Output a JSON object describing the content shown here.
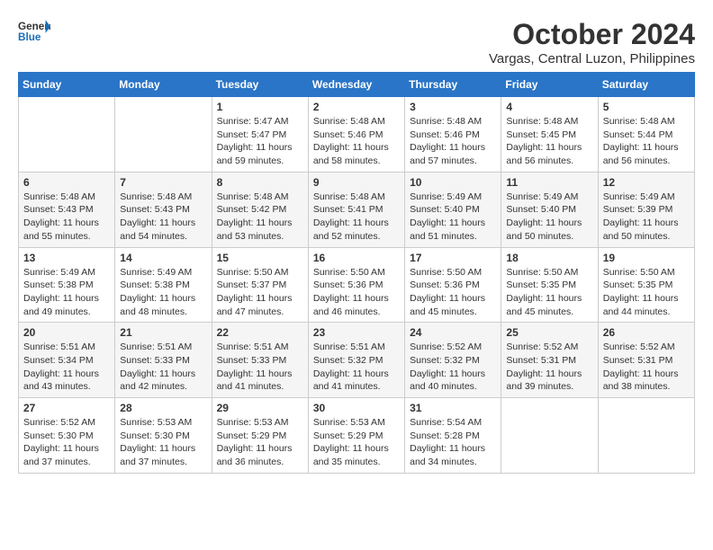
{
  "header": {
    "logo_line1": "General",
    "logo_line2": "Blue",
    "month_title": "October 2024",
    "location": "Vargas, Central Luzon, Philippines"
  },
  "weekdays": [
    "Sunday",
    "Monday",
    "Tuesday",
    "Wednesday",
    "Thursday",
    "Friday",
    "Saturday"
  ],
  "weeks": [
    [
      {
        "day": "",
        "info": ""
      },
      {
        "day": "",
        "info": ""
      },
      {
        "day": "1",
        "info": "Sunrise: 5:47 AM\nSunset: 5:47 PM\nDaylight: 11 hours and 59 minutes."
      },
      {
        "day": "2",
        "info": "Sunrise: 5:48 AM\nSunset: 5:46 PM\nDaylight: 11 hours and 58 minutes."
      },
      {
        "day": "3",
        "info": "Sunrise: 5:48 AM\nSunset: 5:46 PM\nDaylight: 11 hours and 57 minutes."
      },
      {
        "day": "4",
        "info": "Sunrise: 5:48 AM\nSunset: 5:45 PM\nDaylight: 11 hours and 56 minutes."
      },
      {
        "day": "5",
        "info": "Sunrise: 5:48 AM\nSunset: 5:44 PM\nDaylight: 11 hours and 56 minutes."
      }
    ],
    [
      {
        "day": "6",
        "info": "Sunrise: 5:48 AM\nSunset: 5:43 PM\nDaylight: 11 hours and 55 minutes."
      },
      {
        "day": "7",
        "info": "Sunrise: 5:48 AM\nSunset: 5:43 PM\nDaylight: 11 hours and 54 minutes."
      },
      {
        "day": "8",
        "info": "Sunrise: 5:48 AM\nSunset: 5:42 PM\nDaylight: 11 hours and 53 minutes."
      },
      {
        "day": "9",
        "info": "Sunrise: 5:48 AM\nSunset: 5:41 PM\nDaylight: 11 hours and 52 minutes."
      },
      {
        "day": "10",
        "info": "Sunrise: 5:49 AM\nSunset: 5:40 PM\nDaylight: 11 hours and 51 minutes."
      },
      {
        "day": "11",
        "info": "Sunrise: 5:49 AM\nSunset: 5:40 PM\nDaylight: 11 hours and 50 minutes."
      },
      {
        "day": "12",
        "info": "Sunrise: 5:49 AM\nSunset: 5:39 PM\nDaylight: 11 hours and 50 minutes."
      }
    ],
    [
      {
        "day": "13",
        "info": "Sunrise: 5:49 AM\nSunset: 5:38 PM\nDaylight: 11 hours and 49 minutes."
      },
      {
        "day": "14",
        "info": "Sunrise: 5:49 AM\nSunset: 5:38 PM\nDaylight: 11 hours and 48 minutes."
      },
      {
        "day": "15",
        "info": "Sunrise: 5:50 AM\nSunset: 5:37 PM\nDaylight: 11 hours and 47 minutes."
      },
      {
        "day": "16",
        "info": "Sunrise: 5:50 AM\nSunset: 5:36 PM\nDaylight: 11 hours and 46 minutes."
      },
      {
        "day": "17",
        "info": "Sunrise: 5:50 AM\nSunset: 5:36 PM\nDaylight: 11 hours and 45 minutes."
      },
      {
        "day": "18",
        "info": "Sunrise: 5:50 AM\nSunset: 5:35 PM\nDaylight: 11 hours and 45 minutes."
      },
      {
        "day": "19",
        "info": "Sunrise: 5:50 AM\nSunset: 5:35 PM\nDaylight: 11 hours and 44 minutes."
      }
    ],
    [
      {
        "day": "20",
        "info": "Sunrise: 5:51 AM\nSunset: 5:34 PM\nDaylight: 11 hours and 43 minutes."
      },
      {
        "day": "21",
        "info": "Sunrise: 5:51 AM\nSunset: 5:33 PM\nDaylight: 11 hours and 42 minutes."
      },
      {
        "day": "22",
        "info": "Sunrise: 5:51 AM\nSunset: 5:33 PM\nDaylight: 11 hours and 41 minutes."
      },
      {
        "day": "23",
        "info": "Sunrise: 5:51 AM\nSunset: 5:32 PM\nDaylight: 11 hours and 41 minutes."
      },
      {
        "day": "24",
        "info": "Sunrise: 5:52 AM\nSunset: 5:32 PM\nDaylight: 11 hours and 40 minutes."
      },
      {
        "day": "25",
        "info": "Sunrise: 5:52 AM\nSunset: 5:31 PM\nDaylight: 11 hours and 39 minutes."
      },
      {
        "day": "26",
        "info": "Sunrise: 5:52 AM\nSunset: 5:31 PM\nDaylight: 11 hours and 38 minutes."
      }
    ],
    [
      {
        "day": "27",
        "info": "Sunrise: 5:52 AM\nSunset: 5:30 PM\nDaylight: 11 hours and 37 minutes."
      },
      {
        "day": "28",
        "info": "Sunrise: 5:53 AM\nSunset: 5:30 PM\nDaylight: 11 hours and 37 minutes."
      },
      {
        "day": "29",
        "info": "Sunrise: 5:53 AM\nSunset: 5:29 PM\nDaylight: 11 hours and 36 minutes."
      },
      {
        "day": "30",
        "info": "Sunrise: 5:53 AM\nSunset: 5:29 PM\nDaylight: 11 hours and 35 minutes."
      },
      {
        "day": "31",
        "info": "Sunrise: 5:54 AM\nSunset: 5:28 PM\nDaylight: 11 hours and 34 minutes."
      },
      {
        "day": "",
        "info": ""
      },
      {
        "day": "",
        "info": ""
      }
    ]
  ]
}
